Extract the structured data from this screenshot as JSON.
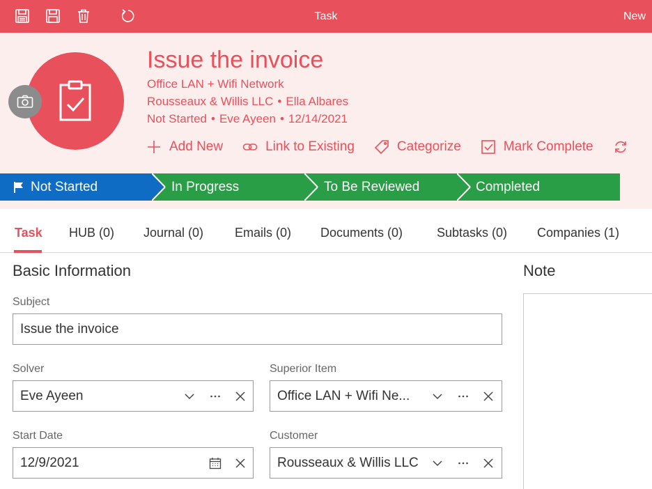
{
  "toolbar": {
    "title": "Task",
    "new_label": "New",
    "accent": "#e8505b",
    "icons": [
      "save-close-icon",
      "save-icon",
      "delete-icon",
      "refresh-icon"
    ]
  },
  "header": {
    "title": "Issue the invoice",
    "project": "Office LAN + Wifi Network",
    "customer": "Rousseaux & Willis LLC",
    "contact": "Ella Albares",
    "status": "Not Started",
    "solver": "Eve Ayeen",
    "date": "12/14/2021",
    "separator": "•",
    "actions": {
      "add_new": "Add New",
      "link_existing": "Link to Existing",
      "categorize": "Categorize",
      "mark_complete": "Mark Complete"
    }
  },
  "status_bar": {
    "stages": [
      {
        "label": "Not Started",
        "color": "#0e6cc4",
        "current": true
      },
      {
        "label": "In Progress",
        "color": "#2a9d47"
      },
      {
        "label": "To Be Reviewed",
        "color": "#2a9d47"
      },
      {
        "label": "Completed",
        "color": "#2a9d47"
      }
    ]
  },
  "tabs": [
    {
      "label": "Task",
      "active": true
    },
    {
      "label": "HUB (0)"
    },
    {
      "label": "Journal (0)"
    },
    {
      "label": "Emails (0)"
    },
    {
      "label": "Documents (0)"
    },
    {
      "label": "Subtasks (0)"
    },
    {
      "label": "Companies (1)"
    }
  ],
  "form": {
    "section_title": "Basic Information",
    "note_title": "Note",
    "subject": {
      "label": "Subject",
      "value": "Issue the invoice"
    },
    "solver": {
      "label": "Solver",
      "value": "Eve Ayeen"
    },
    "superior_item": {
      "label": "Superior Item",
      "value": "Office LAN + Wifi Ne..."
    },
    "start_date": {
      "label": "Start Date",
      "value": "12/9/2021"
    },
    "customer": {
      "label": "Customer",
      "value": "Rousseaux & Willis LLC"
    }
  }
}
